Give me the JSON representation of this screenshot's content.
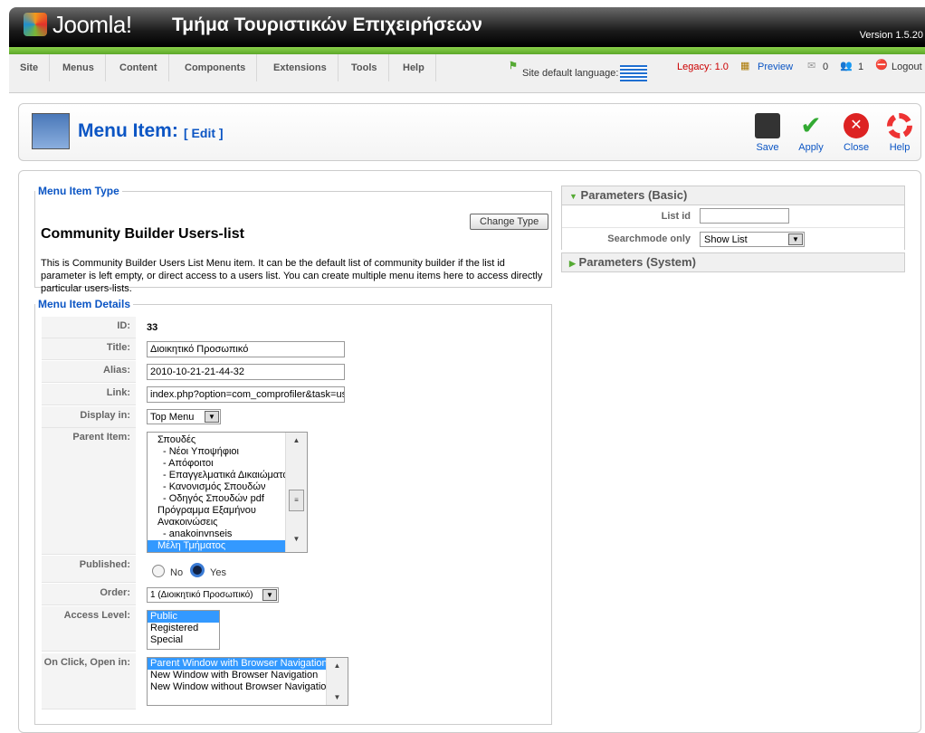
{
  "header": {
    "logo": "Joomla!",
    "site_name": "Τμήμα Τουριστικών Επιχειρήσεων",
    "version": "Version 1.5.20"
  },
  "menu": [
    "Site",
    "Menus",
    "Content",
    "Components",
    "Extensions",
    "Tools",
    "Help"
  ],
  "status": {
    "language_label": "Site default language:",
    "legacy": "Legacy: 1.0",
    "preview": "Preview",
    "messages": "0",
    "users": "1",
    "logout": "Logout"
  },
  "toolbar": {
    "title": "Menu Item:",
    "subtitle": "[ Edit ]",
    "save": "Save",
    "apply": "Apply",
    "close": "Close",
    "help": "Help"
  },
  "type": {
    "legend": "Menu Item Type",
    "change": "Change Type",
    "name": "Community Builder Users-list",
    "desc": "This is Community Builder Users List Menu item. It can be the default list of community builder if the list id parameter is left empty, or direct access to a users list. You can create multiple menu items here to access directly particular users-lists."
  },
  "details": {
    "legend": "Menu Item Details",
    "id_label": "ID:",
    "id": "33",
    "title_label": "Title:",
    "title": "Διοικητικό Προσωπικό",
    "alias_label": "Alias:",
    "alias": "2010-10-21-21-44-32",
    "link_label": "Link:",
    "link": "index.php?option=com_comprofiler&task=usersList",
    "display_label": "Display in:",
    "display": "Top Menu",
    "parent_label": "Parent Item:",
    "parent_items": [
      "Σπουδές",
      "- Νέοι Υποψήφιοι",
      "- Απόφοιτοι",
      "- Επαγγελματικά Δικαιώματα",
      "- Κανονισμός Σπουδών",
      "- Οδηγός Σπουδών pdf",
      "Πρόγραμμα Εξαμήνου",
      "Ανακοινώσεις",
      "- anakoinvnseis",
      "Μέλη Τμήματος"
    ],
    "published_label": "Published:",
    "no": "No",
    "yes": "Yes",
    "order_label": "Order:",
    "order": "1 (Διοικητικό Προσωπικό)",
    "access_label": "Access Level:",
    "access": [
      "Public",
      "Registered",
      "Special"
    ],
    "onclick_label": "On Click, Open in:",
    "onclick": [
      "Parent Window with Browser Navigation",
      "New Window with Browser Navigation",
      "New Window without Browser Navigation"
    ]
  },
  "params": {
    "basic": "Parameters (Basic)",
    "list_id_label": "List id",
    "list_id": "",
    "searchmode_label": "Searchmode only",
    "searchmode": "Show List",
    "system": "Parameters (System)"
  }
}
